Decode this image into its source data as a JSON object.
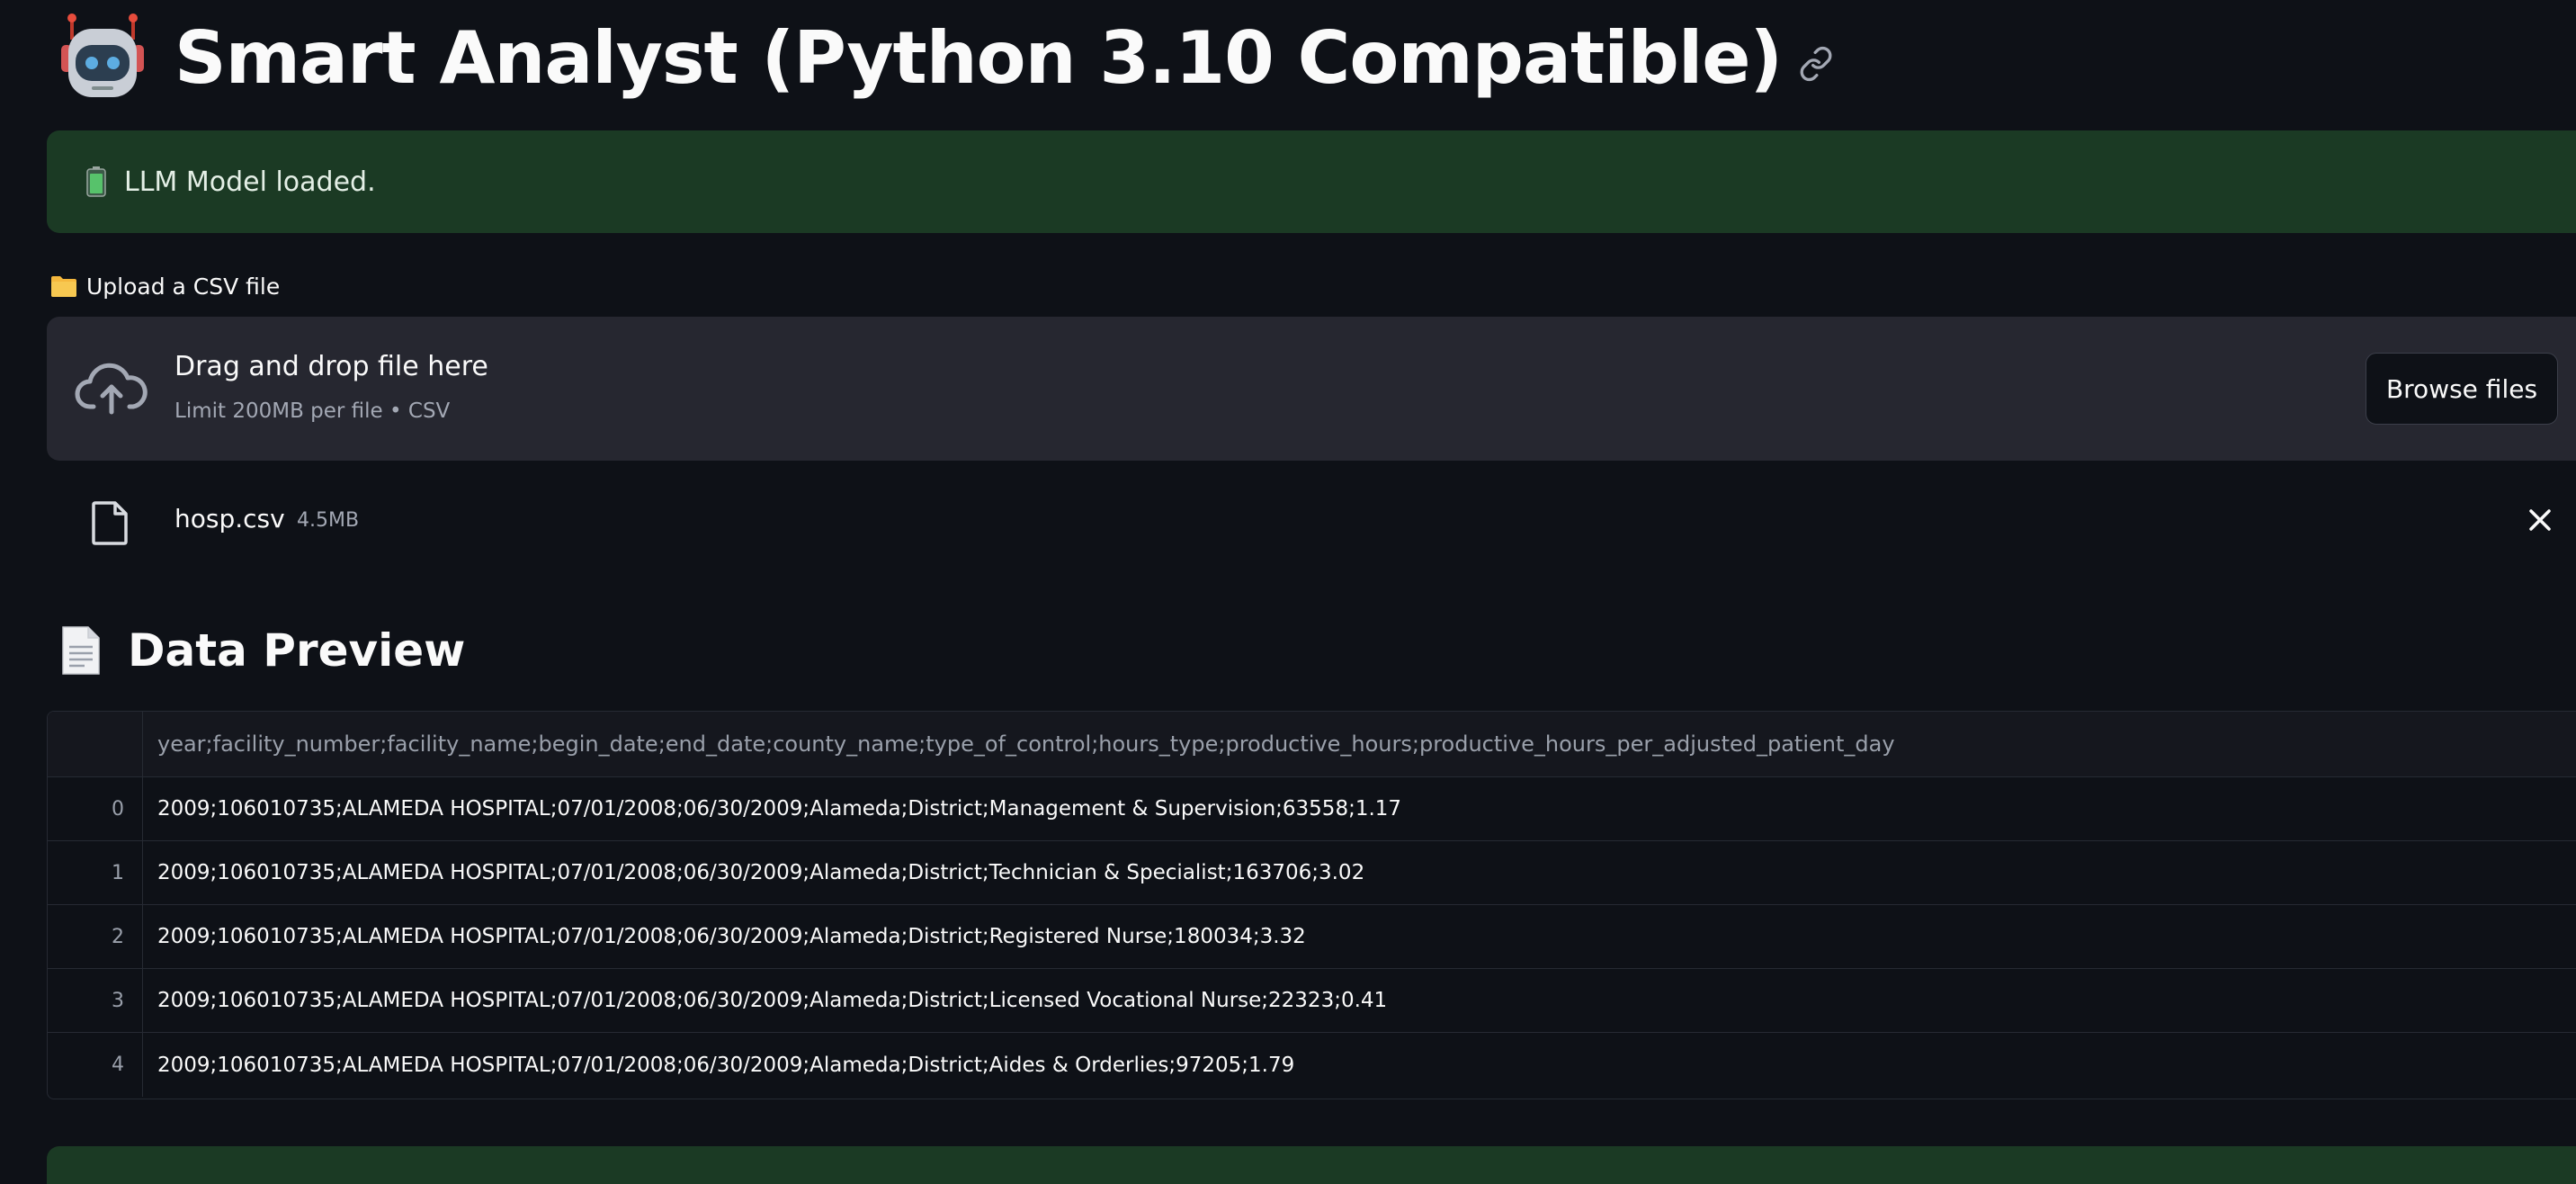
{
  "header": {
    "title": "Smart Analyst (Python 3.10 Compatible)",
    "title_icon": "robot-icon",
    "anchor_icon": "link-icon"
  },
  "status": {
    "message": "LLM Model loaded.",
    "icon": "battery-icon",
    "color": "#1b3a24"
  },
  "uploader": {
    "label": "Upload a CSV file",
    "label_icon": "folder-icon",
    "dropzone_title": "Drag and drop file here",
    "dropzone_subtitle": "Limit 200MB per file • CSV",
    "browse_label": "Browse files",
    "file": {
      "name": "hosp.csv",
      "size": "4.5MB"
    }
  },
  "preview": {
    "heading": "Data Preview",
    "heading_icon": "document-icon",
    "column_header": "year;facility_number;facility_name;begin_date;end_date;county_name;type_of_control;hours_type;productive_hours;productive_hours_per_adjusted_patient_day",
    "rows": [
      {
        "index": "0",
        "value": "2009;106010735;ALAMEDA HOSPITAL;07/01/2008;06/30/2009;Alameda;District;Management & Supervision;63558;1.17"
      },
      {
        "index": "1",
        "value": "2009;106010735;ALAMEDA HOSPITAL;07/01/2008;06/30/2009;Alameda;District;Technician & Specialist;163706;3.02"
      },
      {
        "index": "2",
        "value": "2009;106010735;ALAMEDA HOSPITAL;07/01/2008;06/30/2009;Alameda;District;Registered Nurse;180034;3.32"
      },
      {
        "index": "3",
        "value": "2009;106010735;ALAMEDA HOSPITAL;07/01/2008;06/30/2009;Alameda;District;Licensed Vocational Nurse;22323;0.41"
      },
      {
        "index": "4",
        "value": "2009;106010735;ALAMEDA HOSPITAL;07/01/2008;06/30/2009;Alameda;District;Aides & Orderlies;97205;1.79"
      }
    ]
  },
  "theme": {
    "background": "#0e1117",
    "surface": "#262730",
    "success": "#1b3a24"
  }
}
